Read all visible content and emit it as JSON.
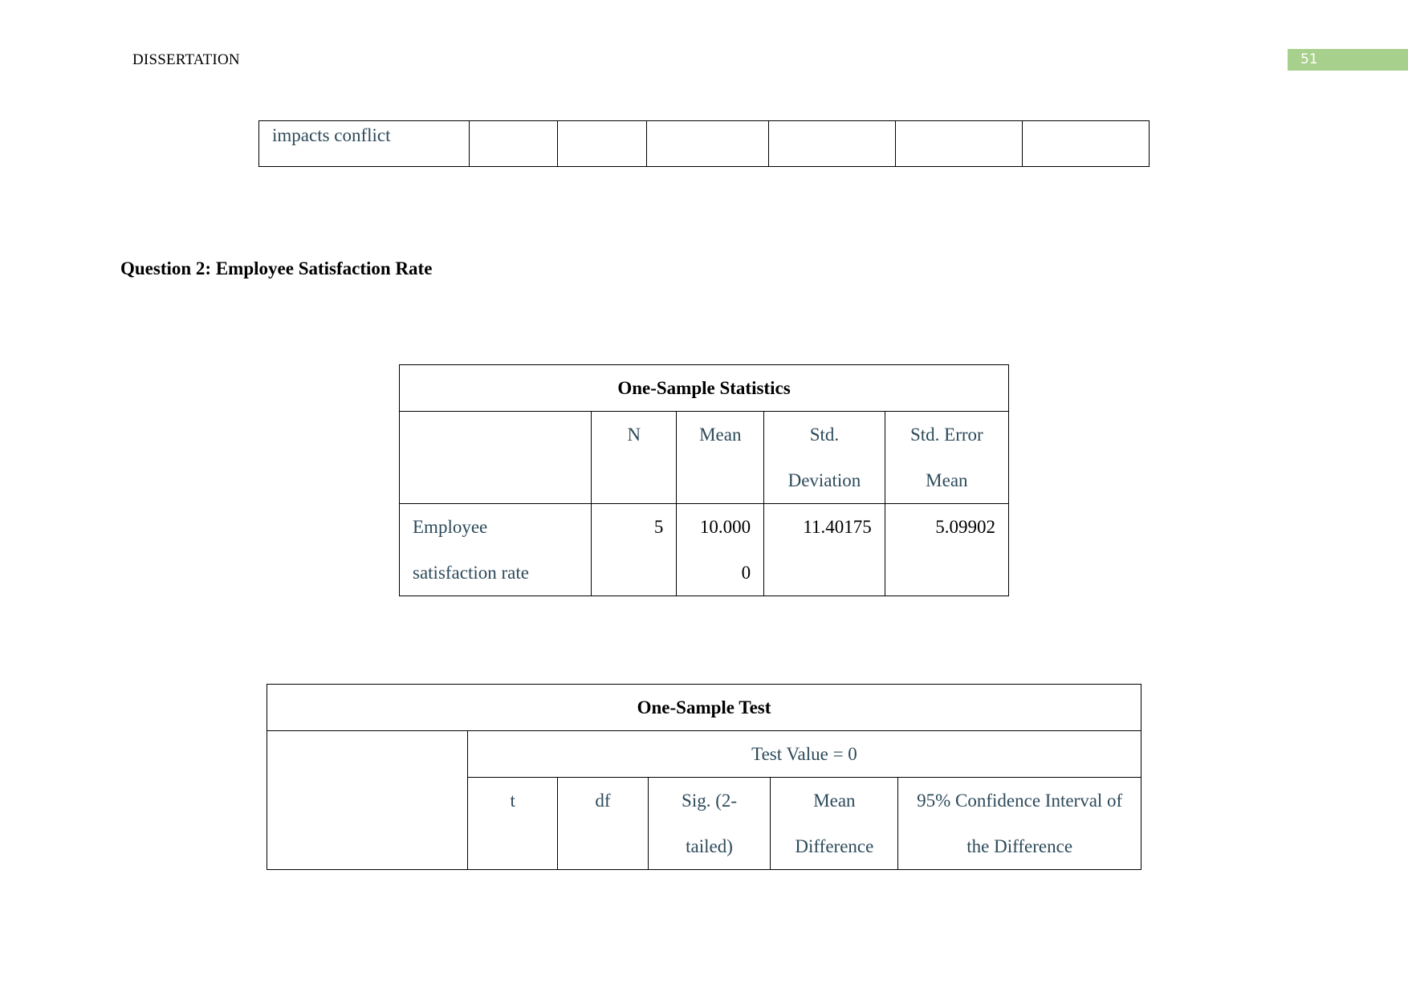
{
  "header": {
    "running_title": "DISSERTATION",
    "page_number": "51",
    "page_badge_color": "#a8d08d"
  },
  "continued_table": {
    "first_cell": "impacts conflict",
    "empty_cells": 6
  },
  "section_heading": "Question 2: Employee Satisfaction Rate",
  "one_sample_statistics": {
    "title": "One-Sample Statistics",
    "columns": [
      "",
      "N",
      "Mean",
      "Std. Deviation",
      "Std. Error Mean"
    ],
    "col_lines": {
      "std_dev": [
        "Std.",
        "Deviation"
      ],
      "std_err": [
        "Std. Error",
        "Mean"
      ]
    },
    "rows": [
      {
        "label_lines": [
          "Employee",
          "satisfaction rate"
        ],
        "n": "5",
        "mean_lines": [
          "10.000",
          "0"
        ],
        "std_dev": "11.40175",
        "std_err": "5.09902"
      }
    ]
  },
  "one_sample_test": {
    "title": "One-Sample Test",
    "test_value": "Test Value = 0",
    "columns": [
      {
        "lines": [
          "t"
        ]
      },
      {
        "lines": [
          "df"
        ]
      },
      {
        "lines": [
          "Sig. (2-",
          "tailed)"
        ]
      },
      {
        "lines": [
          "Mean",
          "Difference"
        ]
      },
      {
        "lines": [
          "95% Confidence Interval of",
          "the Difference"
        ]
      }
    ]
  }
}
